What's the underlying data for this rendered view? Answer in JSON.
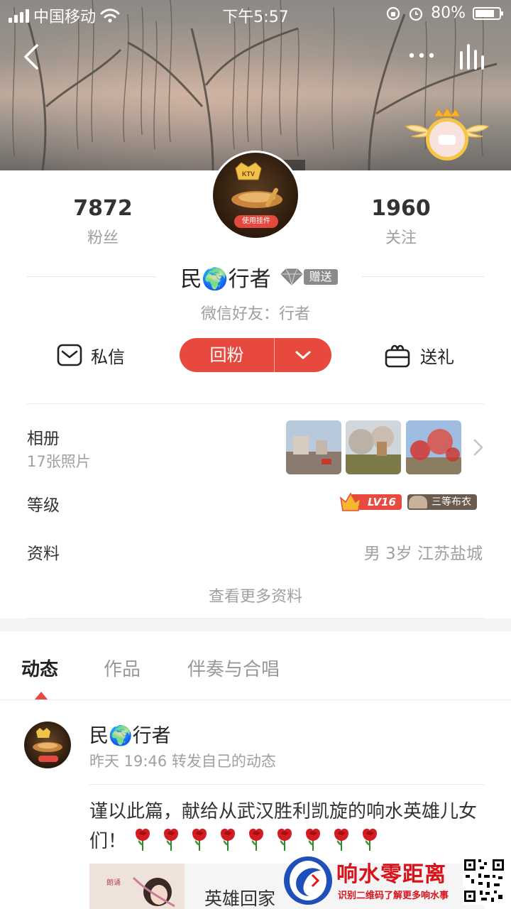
{
  "status_bar": {
    "carrier": "中国移动",
    "time": "下午5:57",
    "battery": "80%",
    "battery_level": 0.8
  },
  "profile": {
    "fans_count": "7872",
    "fans_label": "粉丝",
    "following_count": "1960",
    "following_label": "关注",
    "avatar_tag": "使用挂件",
    "name": "民🌍行者",
    "gift_tag": "赠送",
    "wechat_friend": "微信好友：行者"
  },
  "actions": {
    "message": "私信",
    "follow_back": "回粉",
    "send_gift": "送礼"
  },
  "album": {
    "label": "相册",
    "count": "17张照片"
  },
  "level": {
    "label": "等级",
    "level_badge": "LV16",
    "rank_badge": "三等布衣"
  },
  "info": {
    "label": "资料",
    "value": "男 3岁 江苏盐城",
    "more": "查看更多资料"
  },
  "tabs": [
    {
      "label": "动态",
      "active": true
    },
    {
      "label": "作品",
      "active": false
    },
    {
      "label": "伴奏与合唱",
      "active": false
    }
  ],
  "feed": {
    "name": "民🌍行者",
    "meta": "昨天 19:46  转发自己的动态",
    "text": "谨以此篇，献给从武汉胜利凯旋的响水英雄儿女们！",
    "rose_count": 9,
    "card_title": "英雄回家"
  },
  "watermark": {
    "title": "响水零距离",
    "subtitle": "识别二维码了解更多响水事"
  },
  "colors": {
    "accent": "#e8493f",
    "muted_text": "#a0a0a0"
  }
}
